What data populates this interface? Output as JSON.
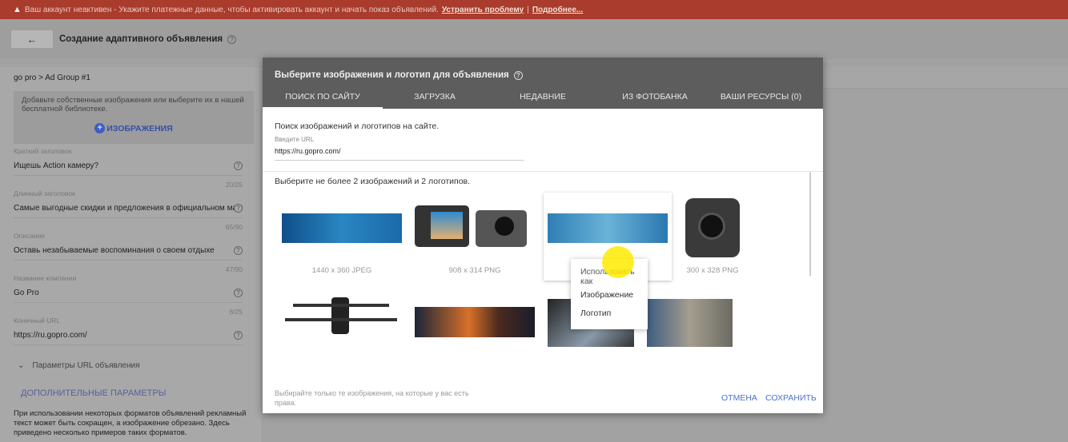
{
  "banner": {
    "text": "Ваш аккаунт неактивен - Укажите платежные данные, чтобы активировать аккаунт и начать показ объявлений.",
    "fix_link": "Устранить проблему",
    "sep": "|",
    "more_link": "Подробнее..."
  },
  "header": {
    "back": "←",
    "title": "Создание адаптивного объявления"
  },
  "left": {
    "breadcrumb": "go pro > Ad Group #1",
    "add_text": "Добавьте собственные изображения или выберите их в нашей бесплатной библиотеке.",
    "add_button": "ИЗОБРАЖЕНИЯ",
    "fields": [
      {
        "label": "Краткий заголовок",
        "value": "Ищешь Action камеру?",
        "count": "20/25"
      },
      {
        "label": "Длинный заголовок",
        "value": "Самые выгодные скидки и предложения в официальном магазине",
        "count": "65/90"
      },
      {
        "label": "Описание",
        "value": "Оставь незабываемые воспоминания о своем отдыхе",
        "count": "47/90"
      },
      {
        "label": "Название компании",
        "value": "Go Pro",
        "count": "6/25"
      },
      {
        "label": "Конечный URL",
        "value": "https://ru.gopro.com/",
        "count": ""
      }
    ],
    "url_params": "Параметры URL объявления",
    "advanced": "ДОПОЛНИТЕЛЬНЫЕ ПАРАМЕТРЫ",
    "note": "При использовании некоторых форматов объявлений рекламный текст может быть сокращен, а изображение обрезано. Здесь приведено несколько примеров таких форматов."
  },
  "modal": {
    "title": "Выберите изображения и логотип для объявления",
    "tabs": [
      "ПОИСК ПО САЙТУ",
      "ЗАГРУЗКА",
      "НЕДАВНИЕ",
      "ИЗ ФОТОБАНКА",
      "ВАШИ РЕСУРСЫ (0)"
    ],
    "active_tab": 0,
    "search_hint": "Поиск изображений и логотипов на сайте.",
    "url_label": "Введите URL",
    "url_value": "https://ru.gopro.com/",
    "pick_hint": "Выберите не более 2 изображений и 2 логотипов.",
    "captions": [
      "1440 x 360 JPEG",
      "908 x 314 PNG",
      "300 x 328 PNG"
    ],
    "context_menu": {
      "title": "Использовать как",
      "items": [
        "Изображение",
        "Логотип"
      ]
    },
    "footer_note": "Выбирайте только те изображения, на которые у вас есть права.",
    "cancel": "ОТМЕНА",
    "save": "СОХРАНИТЬ"
  }
}
